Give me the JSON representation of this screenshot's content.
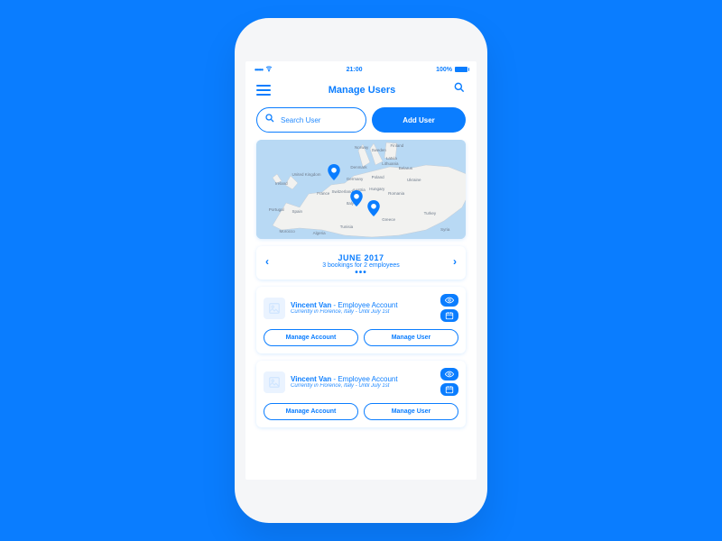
{
  "status": {
    "time": "21:00",
    "battery": "100%"
  },
  "header": {
    "title": "Manage Users"
  },
  "actions": {
    "search_placeholder": "Search User",
    "add_label": "Add User"
  },
  "month": {
    "label": "JUNE 2017",
    "sub": "3 bookings for 2 employees"
  },
  "users": [
    {
      "name": "Vincent Van",
      "role": "Employee Account",
      "sub": "Currently in Florence, Italy - Until July 1st",
      "btn1": "Manage Account",
      "btn2": "Manage User"
    },
    {
      "name": "Vincent Van",
      "role": "Employee Account",
      "sub": "Currently in Florence, Italy - Until July 1st",
      "btn1": "Manage Account",
      "btn2": "Manage User"
    }
  ],
  "map": {
    "countries": [
      "United Kingdom",
      "Ireland",
      "Norway",
      "Sweden",
      "Finland",
      "Denmark",
      "Germany",
      "Poland",
      "France",
      "Spain",
      "Portugal",
      "Morocco",
      "Algeria",
      "Tunisia",
      "Italy",
      "Ukraine",
      "Belarus",
      "Lithuania",
      "Latvia",
      "Turkey",
      "Syria",
      "Greece",
      "Romania",
      "Austria",
      "Hungary",
      "Switzerland"
    ]
  }
}
